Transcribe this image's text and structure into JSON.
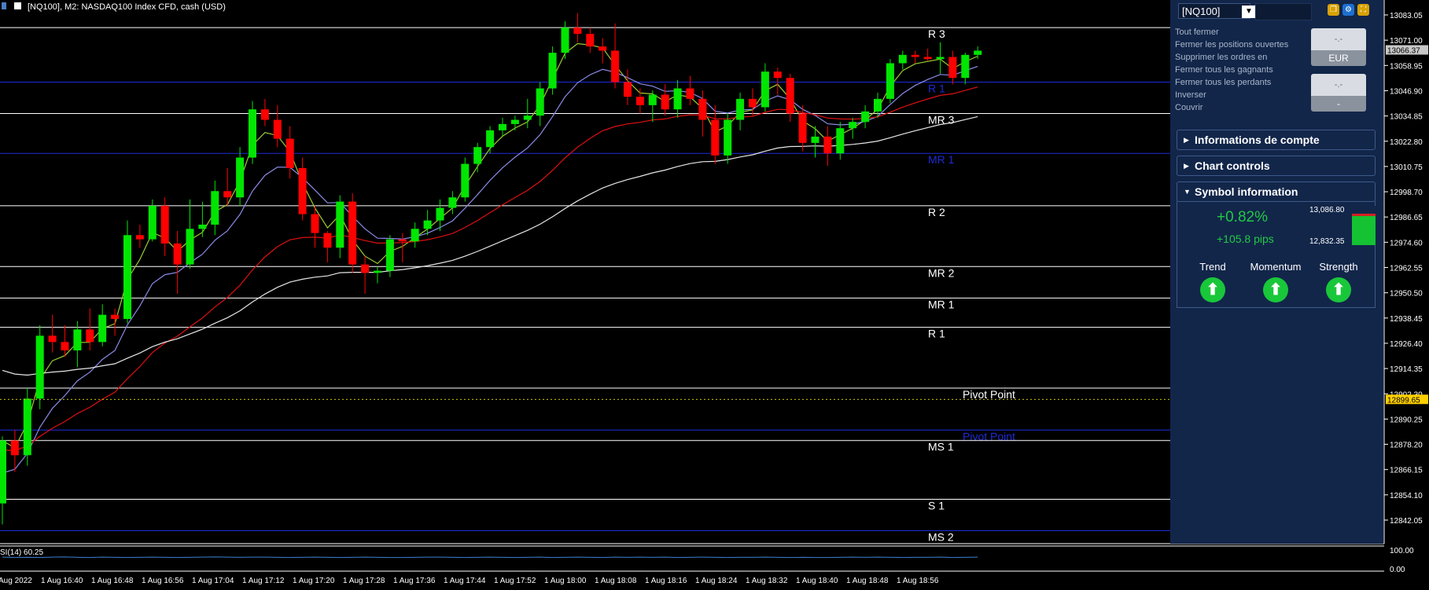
{
  "window": {
    "title": "[NQ100], M2:  NASDAQ100 Index CFD, cash (USD)"
  },
  "chart_data": {
    "type": "candlestick",
    "symbol": "NQ100",
    "timeframe": "M2",
    "price_axis": {
      "ticks": [
        "13083.05",
        "13071.00",
        "13058.95",
        "13046.90",
        "13034.85",
        "13022.80",
        "13010.75",
        "12998.70",
        "12986.65",
        "12974.60",
        "12962.55",
        "12950.50",
        "12938.45",
        "12926.40",
        "12914.35",
        "12902.30",
        "12890.25",
        "12878.20",
        "12866.15",
        "12854.10",
        "12842.05"
      ],
      "current_price": "13066.37",
      "pivot_marker": "12899.65"
    },
    "time_axis": [
      "Aug 2022",
      "1 Aug 16:40",
      "1 Aug 16:48",
      "1 Aug 16:56",
      "1 Aug 17:04",
      "1 Aug 17:12",
      "1 Aug 17:20",
      "1 Aug 17:28",
      "1 Aug 17:36",
      "1 Aug 17:44",
      "1 Aug 17:52",
      "1 Aug 18:00",
      "1 Aug 18:08",
      "1 Aug 18:16",
      "1 Aug 18:24",
      "1 Aug 18:32",
      "1 Aug 18:40",
      "1 Aug 18:48",
      "1 Aug 18:56"
    ],
    "candles": [
      {
        "o": 12850,
        "h": 12882,
        "l": 12840,
        "c": 12880
      },
      {
        "o": 12880,
        "h": 12885,
        "l": 12865,
        "c": 12873
      },
      {
        "o": 12873,
        "h": 12905,
        "l": 12868,
        "c": 12900
      },
      {
        "o": 12900,
        "h": 12935,
        "l": 12895,
        "c": 12930
      },
      {
        "o": 12930,
        "h": 12940,
        "l": 12922,
        "c": 12927
      },
      {
        "o": 12927,
        "h": 12935,
        "l": 12920,
        "c": 12923
      },
      {
        "o": 12923,
        "h": 12937,
        "l": 12915,
        "c": 12933
      },
      {
        "o": 12933,
        "h": 12943,
        "l": 12923,
        "c": 12927
      },
      {
        "o": 12927,
        "h": 12945,
        "l": 12925,
        "c": 12940
      },
      {
        "o": 12940,
        "h": 12943,
        "l": 12930,
        "c": 12938
      },
      {
        "o": 12938,
        "h": 12985,
        "l": 12936,
        "c": 12978
      },
      {
        "o": 12978,
        "h": 12983,
        "l": 12972,
        "c": 12976
      },
      {
        "o": 12976,
        "h": 12995,
        "l": 12975,
        "c": 12992
      },
      {
        "o": 12992,
        "h": 12996,
        "l": 12968,
        "c": 12974
      },
      {
        "o": 12974,
        "h": 12980,
        "l": 12950,
        "c": 12964
      },
      {
        "o": 12964,
        "h": 12995,
        "l": 12962,
        "c": 12981
      },
      {
        "o": 12981,
        "h": 12994,
        "l": 12977,
        "c": 12983
      },
      {
        "o": 12983,
        "h": 13004,
        "l": 12978,
        "c": 12999
      },
      {
        "o": 12999,
        "h": 13010,
        "l": 12992,
        "c": 12996
      },
      {
        "o": 12996,
        "h": 13020,
        "l": 12992,
        "c": 13015
      },
      {
        "o": 13015,
        "h": 13042,
        "l": 13012,
        "c": 13038
      },
      {
        "o": 13038,
        "h": 13043,
        "l": 13030,
        "c": 13033
      },
      {
        "o": 13033,
        "h": 13040,
        "l": 13020,
        "c": 13024
      },
      {
        "o": 13024,
        "h": 13030,
        "l": 13005,
        "c": 13010
      },
      {
        "o": 13010,
        "h": 13015,
        "l": 12985,
        "c": 12988
      },
      {
        "o": 12988,
        "h": 12992,
        "l": 12972,
        "c": 12979
      },
      {
        "o": 12979,
        "h": 12980,
        "l": 12965,
        "c": 12972
      },
      {
        "o": 12972,
        "h": 12997,
        "l": 12967,
        "c": 12994
      },
      {
        "o": 12994,
        "h": 12998,
        "l": 12960,
        "c": 12964
      },
      {
        "o": 12964,
        "h": 12968,
        "l": 12950,
        "c": 12960
      },
      {
        "o": 12960,
        "h": 12963,
        "l": 12955,
        "c": 12961
      },
      {
        "o": 12961,
        "h": 12978,
        "l": 12958,
        "c": 12976
      },
      {
        "o": 12976,
        "h": 12979,
        "l": 12965,
        "c": 12975
      },
      {
        "o": 12975,
        "h": 12984,
        "l": 12972,
        "c": 12981
      },
      {
        "o": 12981,
        "h": 12990,
        "l": 12978,
        "c": 12985
      },
      {
        "o": 12985,
        "h": 12995,
        "l": 12980,
        "c": 12991
      },
      {
        "o": 12991,
        "h": 12999,
        "l": 12988,
        "c": 12996
      },
      {
        "o": 12996,
        "h": 13015,
        "l": 12994,
        "c": 13012
      },
      {
        "o": 13012,
        "h": 13022,
        "l": 13008,
        "c": 13020
      },
      {
        "o": 13020,
        "h": 13030,
        "l": 13017,
        "c": 13028
      },
      {
        "o": 13028,
        "h": 13034,
        "l": 13025,
        "c": 13031
      },
      {
        "o": 13031,
        "h": 13035,
        "l": 13028,
        "c": 13033
      },
      {
        "o": 13033,
        "h": 13043,
        "l": 13029,
        "c": 13035
      },
      {
        "o": 13035,
        "h": 13051,
        "l": 13030,
        "c": 13048
      },
      {
        "o": 13048,
        "h": 13068,
        "l": 13045,
        "c": 13065
      },
      {
        "o": 13065,
        "h": 13080,
        "l": 13062,
        "c": 13077
      },
      {
        "o": 13077,
        "h": 13084,
        "l": 13070,
        "c": 13074
      },
      {
        "o": 13074,
        "h": 13077,
        "l": 13065,
        "c": 13068
      },
      {
        "o": 13068,
        "h": 13072,
        "l": 13060,
        "c": 13066
      },
      {
        "o": 13066,
        "h": 13079,
        "l": 13048,
        "c": 13051
      },
      {
        "o": 13051,
        "h": 13057,
        "l": 13040,
        "c": 13044
      },
      {
        "o": 13044,
        "h": 13048,
        "l": 13036,
        "c": 13040
      },
      {
        "o": 13040,
        "h": 13047,
        "l": 13032,
        "c": 13045
      },
      {
        "o": 13045,
        "h": 13050,
        "l": 13035,
        "c": 13038
      },
      {
        "o": 13038,
        "h": 13052,
        "l": 13034,
        "c": 13048
      },
      {
        "o": 13048,
        "h": 13054,
        "l": 13040,
        "c": 13043
      },
      {
        "o": 13043,
        "h": 13047,
        "l": 13025,
        "c": 13033
      },
      {
        "o": 13033,
        "h": 13040,
        "l": 13012,
        "c": 13016
      },
      {
        "o": 13016,
        "h": 13036,
        "l": 13012,
        "c": 13033
      },
      {
        "o": 13033,
        "h": 13046,
        "l": 13028,
        "c": 13043
      },
      {
        "o": 13043,
        "h": 13048,
        "l": 13035,
        "c": 13039
      },
      {
        "o": 13039,
        "h": 13060,
        "l": 13037,
        "c": 13056
      },
      {
        "o": 13056,
        "h": 13058,
        "l": 13045,
        "c": 13053
      },
      {
        "o": 13053,
        "h": 13055,
        "l": 13032,
        "c": 13036
      },
      {
        "o": 13036,
        "h": 13040,
        "l": 13018,
        "c": 13022
      },
      {
        "o": 13022,
        "h": 13030,
        "l": 13015,
        "c": 13025
      },
      {
        "o": 13025,
        "h": 13030,
        "l": 13011,
        "c": 13017
      },
      {
        "o": 13017,
        "h": 13032,
        "l": 13014,
        "c": 13029
      },
      {
        "o": 13029,
        "h": 13034,
        "l": 13024,
        "c": 13032
      },
      {
        "o": 13032,
        "h": 13040,
        "l": 13029,
        "c": 13037
      },
      {
        "o": 13037,
        "h": 13046,
        "l": 13034,
        "c": 13043
      },
      {
        "o": 13043,
        "h": 13062,
        "l": 13041,
        "c": 13060
      },
      {
        "o": 13060,
        "h": 13066,
        "l": 13057,
        "c": 13064
      },
      {
        "o": 13064,
        "h": 13066,
        "l": 13060,
        "c": 13063
      },
      {
        "o": 13063,
        "h": 13067,
        "l": 13061,
        "c": 13062
      },
      {
        "o": 13062,
        "h": 13070,
        "l": 13055,
        "c": 13063
      },
      {
        "o": 13063,
        "h": 13066,
        "l": 13050,
        "c": 13053
      },
      {
        "o": 13053,
        "h": 13065,
        "l": 13050,
        "c": 13064
      },
      {
        "o": 13064,
        "h": 13068,
        "l": 13062,
        "c": 13066
      }
    ],
    "pivot_lines": [
      {
        "label": "R 3",
        "price": 13077,
        "color": "#ffffff",
        "label_color": "#ffffff"
      },
      {
        "label": "R 1",
        "price": 13051,
        "color": "#1f2bd6",
        "label_color": "#1f2bd6"
      },
      {
        "label": "MR 3",
        "price": 13036,
        "color": "#ffffff",
        "label_color": "#ffffff"
      },
      {
        "label": "MR 1",
        "price": 13017,
        "color": "#1f2bd6",
        "label_color": "#1f2bd6"
      },
      {
        "label": "R 2",
        "price": 12992,
        "color": "#ffffff",
        "label_color": "#ffffff"
      },
      {
        "label": "MR 2",
        "price": 12963,
        "color": "#ffffff",
        "label_color": "#ffffff"
      },
      {
        "label": "MR 1",
        "price": 12948,
        "color": "#ffffff",
        "label_color": "#ffffff"
      },
      {
        "label": "R 1",
        "price": 12934,
        "color": "#ffffff",
        "label_color": "#ffffff"
      },
      {
        "label": "Pivot Point",
        "price": 12905,
        "color": "#ffffff",
        "label_color": "#ffffff"
      },
      {
        "label": "Pivot Point",
        "price": 12885,
        "color": "#1f2bd6",
        "label_color": "#1f2bd6"
      },
      {
        "label": "MS 1",
        "price": 12880,
        "color": "#ffffff",
        "label_color": "#ffffff"
      },
      {
        "label": "S 1",
        "price": 12852,
        "color": "#ffffff",
        "label_color": "#ffffff"
      },
      {
        "label": "MS 2",
        "price": 12837,
        "color": "#1f2bd6",
        "label_color": "#ffffff"
      }
    ],
    "rsi": {
      "label": "SI(14) 60.25",
      "ticks": [
        "100.00",
        "0.00"
      ],
      "values": [
        62,
        60,
        61,
        60,
        62,
        63,
        61,
        60,
        62,
        61,
        60,
        61,
        62,
        61,
        60,
        61,
        62,
        63,
        62,
        61,
        62,
        62,
        61,
        60,
        61,
        62,
        61,
        60,
        61,
        62,
        61,
        60,
        60,
        61,
        62,
        62,
        61,
        60,
        61,
        62,
        61,
        60,
        61,
        62,
        60,
        61,
        62,
        61,
        60,
        62,
        61,
        62,
        61,
        62,
        60,
        61,
        62,
        61,
        60,
        61,
        61,
        62,
        61,
        60,
        61,
        60,
        60,
        61,
        62,
        61,
        62,
        61,
        60,
        61,
        61,
        62,
        60,
        61,
        62
      ]
    },
    "colors": {
      "bull": "#00e600",
      "bear": "#ff0000",
      "ma_fast": "#9acd32",
      "ma_mid": "#8b8be8",
      "ma_slow": "#e01010",
      "ma_long": "#e6e6e6",
      "rsi": "#3a7fd0",
      "pivot_marker_bg": "#ffd000"
    }
  },
  "panel": {
    "symbol": "[NQ100]",
    "orders": [
      "Tout fermer",
      "Fermer les positions ouvertes",
      "Supprimer les ordres en",
      "Fermer tous les gagnants",
      "Fermer tous les perdants",
      "Inverser",
      "Couvrir"
    ],
    "pill1": {
      "top": "-.-",
      "bottom": "EUR"
    },
    "pill2": {
      "top": "-.-",
      "bottom": "-"
    },
    "sections": {
      "account": "Informations de compte",
      "chart": "Chart controls",
      "symbol": "Symbol information"
    },
    "symbol_info": {
      "change_pct": "+0.82%",
      "change_pips": "+105.8 pips",
      "high": "13,086.80",
      "low": "12,832.35",
      "range_fill": 0.8,
      "indicators": [
        {
          "name": "Trend",
          "icon": "up-arrow-icon"
        },
        {
          "name": "Momentum",
          "icon": "up-arrow-icon"
        },
        {
          "name": "Strength",
          "icon": "up-arrow-icon"
        }
      ]
    }
  }
}
